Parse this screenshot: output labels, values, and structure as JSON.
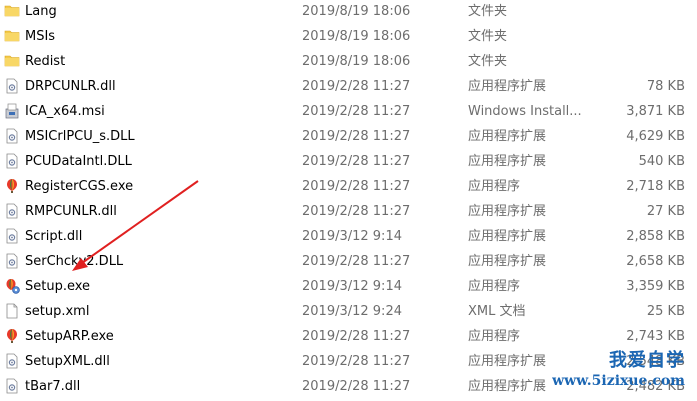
{
  "files": [
    {
      "name": "Lang",
      "date": "2019/8/19 18:06",
      "type": "文件夹",
      "size": "",
      "icon": "folder-icon"
    },
    {
      "name": "MSIs",
      "date": "2019/8/19 18:06",
      "type": "文件夹",
      "size": "",
      "icon": "folder-icon"
    },
    {
      "name": "Redist",
      "date": "2019/8/19 18:06",
      "type": "文件夹",
      "size": "",
      "icon": "folder-icon"
    },
    {
      "name": "DRPCUNLR.dll",
      "date": "2019/2/28 11:27",
      "type": "应用程序扩展",
      "size": "78 KB",
      "icon": "dll-icon"
    },
    {
      "name": "ICA_x64.msi",
      "date": "2019/2/28 11:27",
      "type": "Windows Install...",
      "size": "3,871 KB",
      "icon": "msi-icon"
    },
    {
      "name": "MSICrlPCU_s.DLL",
      "date": "2019/2/28 11:27",
      "type": "应用程序扩展",
      "size": "4,629 KB",
      "icon": "dll-icon"
    },
    {
      "name": "PCUDataIntl.DLL",
      "date": "2019/2/28 11:27",
      "type": "应用程序扩展",
      "size": "540 KB",
      "icon": "dll-icon"
    },
    {
      "name": "RegisterCGS.exe",
      "date": "2019/2/28 11:27",
      "type": "应用程序",
      "size": "2,718 KB",
      "icon": "coreldraw-balloon-icon"
    },
    {
      "name": "RMPCUNLR.dll",
      "date": "2019/2/28 11:27",
      "type": "应用程序扩展",
      "size": "27 KB",
      "icon": "dll-icon"
    },
    {
      "name": "Script.dll",
      "date": "2019/3/12 9:14",
      "type": "应用程序扩展",
      "size": "2,858 KB",
      "icon": "dll-icon"
    },
    {
      "name": "SerChckv2.DLL",
      "date": "2019/2/28 11:27",
      "type": "应用程序扩展",
      "size": "2,658 KB",
      "icon": "dll-icon"
    },
    {
      "name": "Setup.exe",
      "date": "2019/3/12 9:14",
      "type": "应用程序",
      "size": "3,359 KB",
      "icon": "setup-exe-icon"
    },
    {
      "name": "setup.xml",
      "date": "2019/3/12 9:24",
      "type": "XML 文档",
      "size": "25 KB",
      "icon": "xml-file-icon"
    },
    {
      "name": "SetupARP.exe",
      "date": "2019/2/28 11:27",
      "type": "应用程序",
      "size": "2,743 KB",
      "icon": "coreldraw-balloon-icon"
    },
    {
      "name": "SetupXML.dll",
      "date": "2019/2/28 11:27",
      "type": "应用程序扩展",
      "size": "2,548 KB",
      "icon": "dll-icon"
    },
    {
      "name": "tBar7.dll",
      "date": "2019/2/28 11:27",
      "type": "应用程序扩展",
      "size": "2,482 KB",
      "icon": "dll-icon"
    }
  ],
  "watermark": {
    "title": "我爱自学",
    "url": "www.5izixue.com"
  },
  "colors": {
    "arrow": "#e02020",
    "watermark": "#1b66b3",
    "folder": "#f3c948",
    "detail_text": "#6d6d6d"
  }
}
